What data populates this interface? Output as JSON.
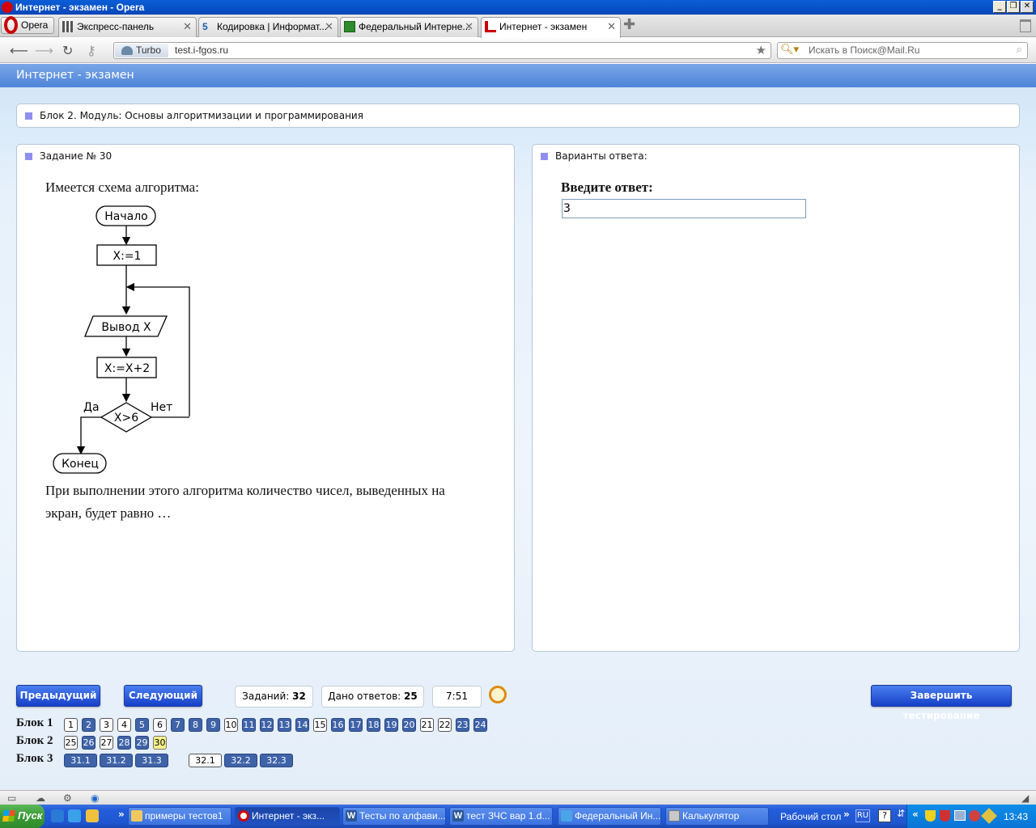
{
  "window": {
    "title": "Интернет - экзамен - Opera"
  },
  "browser": {
    "menu_label": "Opera",
    "tabs": [
      {
        "label": "Экспресс-панель"
      },
      {
        "label": "Кодировка | Информат..."
      },
      {
        "label": "Федеральный Интерне..."
      },
      {
        "label": "Интернет - экзамен"
      }
    ],
    "turbo_label": "Turbo",
    "url": "test.i-fgos.ru",
    "search_placeholder": "Искать в Поиск@Mail.Ru"
  },
  "page": {
    "header": "Интернет - экзамен",
    "module_title": "Блок 2. Модуль: Основы алгоритмизации и программирования",
    "task_title": "Задание № 30",
    "question_intro": "Имеется схема алгоритма:",
    "question_line1": "При выполнении этого алгоритма количество чисел, выведенных на",
    "question_line2": "экран, будет равно …",
    "flowchart": {
      "start": "Начало",
      "assign": "X:=1",
      "output": "Вывод X",
      "increment": "X:=X+2",
      "condition": "X>6",
      "yes": "Да",
      "no": "Нет",
      "end": "Конец"
    },
    "answers_title": "Варианты ответа:",
    "answer_prompt": "Введите ответ:",
    "answer_value": "3"
  },
  "controls": {
    "prev_label": "Предыдущий",
    "next_label": "Следующий",
    "tasks_label": "Заданий:",
    "tasks_count": "32",
    "answered_label": "Дано ответов:",
    "answered_count": "25",
    "timer": "7:51",
    "finish_label": "Завершить тестирование"
  },
  "blocks": [
    {
      "label": "Блок 1",
      "items": [
        {
          "n": "1",
          "state": "empty"
        },
        {
          "n": "2",
          "state": "answered"
        },
        {
          "n": "3",
          "state": "empty"
        },
        {
          "n": "4",
          "state": "empty"
        },
        {
          "n": "5",
          "state": "answered"
        },
        {
          "n": "6",
          "state": "empty"
        },
        {
          "n": "7",
          "state": "answered"
        },
        {
          "n": "8",
          "state": "answered"
        },
        {
          "n": "9",
          "state": "answered"
        },
        {
          "n": "10",
          "state": "empty"
        },
        {
          "n": "11",
          "state": "answered"
        },
        {
          "n": "12",
          "state": "answered"
        },
        {
          "n": "13",
          "state": "answered"
        },
        {
          "n": "14",
          "state": "answered"
        },
        {
          "n": "15",
          "state": "empty"
        },
        {
          "n": "16",
          "state": "answered"
        },
        {
          "n": "17",
          "state": "answered"
        },
        {
          "n": "18",
          "state": "answered"
        },
        {
          "n": "19",
          "state": "answered"
        },
        {
          "n": "20",
          "state": "answered"
        },
        {
          "n": "21",
          "state": "empty"
        },
        {
          "n": "22",
          "state": "empty"
        },
        {
          "n": "23",
          "state": "answered"
        },
        {
          "n": "24",
          "state": "answered"
        }
      ]
    },
    {
      "label": "Блок 2",
      "items": [
        {
          "n": "25",
          "state": "empty"
        },
        {
          "n": "26",
          "state": "answered"
        },
        {
          "n": "27",
          "state": "empty"
        },
        {
          "n": "28",
          "state": "answered"
        },
        {
          "n": "29",
          "state": "answered"
        },
        {
          "n": "30",
          "state": "current"
        }
      ]
    },
    {
      "label": "Блок 3",
      "items": [
        {
          "n": "31.1",
          "state": "answered"
        },
        {
          "n": "31.2",
          "state": "answered"
        },
        {
          "n": "31.3",
          "state": "answered"
        },
        {
          "n": "32.1",
          "state": "empty"
        },
        {
          "n": "32.2",
          "state": "answered"
        },
        {
          "n": "32.3",
          "state": "answered"
        }
      ]
    }
  ],
  "taskbar": {
    "start_label": "Пуск",
    "tasks": [
      {
        "label": "примеры тестов1",
        "icon": "folder-icon"
      },
      {
        "label": "Интернет - экз...",
        "icon": "opera-icon"
      },
      {
        "label": "Тесты по алфави...",
        "icon": "word-icon"
      },
      {
        "label": "тест ЗЧС вар 1.d...",
        "icon": "word-icon"
      },
      {
        "label": "Федеральный Ин...",
        "icon": "ie-icon"
      },
      {
        "label": "Калькулятор",
        "icon": "calculator-icon"
      }
    ],
    "desktop_label": "Рабочий стол",
    "lang": "RU",
    "clock": "13:43"
  },
  "colors": {
    "header_blue": "#5a8fde",
    "answered_blue": "#3f63a8",
    "current_yellow": "#f7f08a",
    "button_blue": "#1f4fd8"
  }
}
